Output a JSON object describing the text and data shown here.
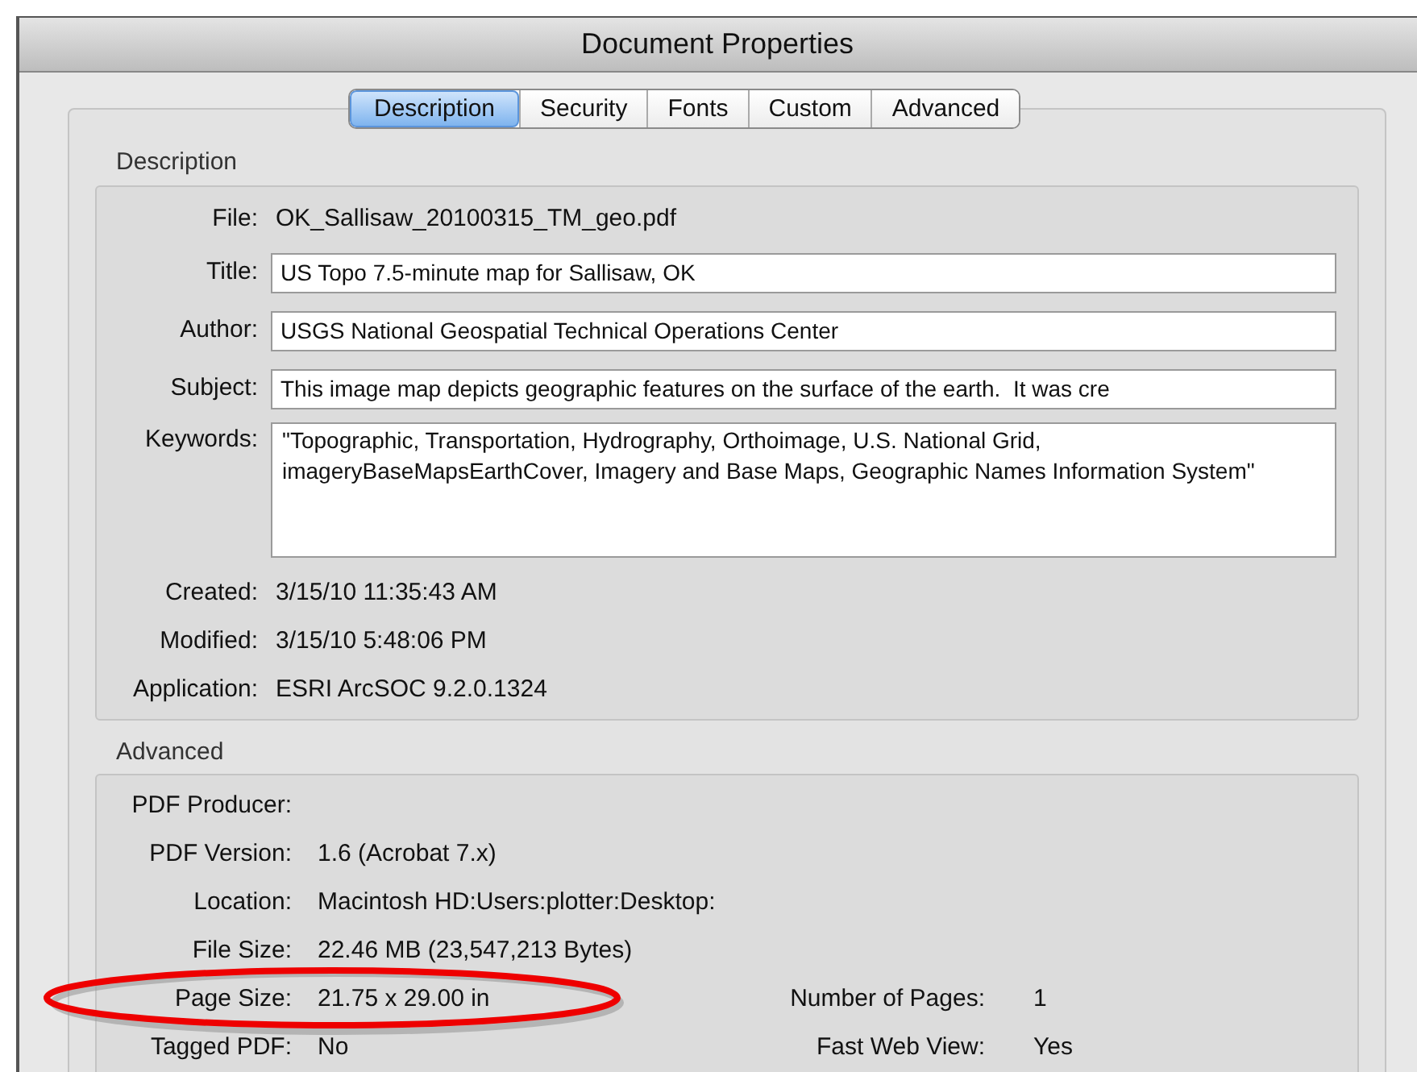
{
  "window": {
    "title": "Document Properties"
  },
  "tabs": [
    {
      "label": "Description",
      "selected": true
    },
    {
      "label": "Security",
      "selected": false
    },
    {
      "label": "Fonts",
      "selected": false
    },
    {
      "label": "Custom",
      "selected": false
    },
    {
      "label": "Advanced",
      "selected": false
    }
  ],
  "description": {
    "title": "Description",
    "fields": [
      {
        "kind": "text",
        "label": "File:",
        "value": "OK_Sallisaw_20100315_TM_geo.pdf"
      },
      {
        "kind": "input",
        "label": "Title:",
        "value": "US Topo 7.5-minute map for Sallisaw, OK"
      },
      {
        "kind": "input",
        "label": "Author:",
        "value": "USGS National Geospatial Technical Operations Center"
      },
      {
        "kind": "input",
        "label": "Subject:",
        "value": "This image map depicts geographic features on the surface of the earth.  It was cre"
      },
      {
        "kind": "textarea",
        "label": "Keywords:",
        "value": "\"Topographic, Transportation, Hydrography, Orthoimage, U.S. National Grid, imageryBaseMapsEarthCover, Imagery and Base Maps, Geographic Names Information System\""
      },
      {
        "kind": "text",
        "label": "Created:",
        "value": "3/15/10 11:35:43 AM"
      },
      {
        "kind": "text",
        "label": "Modified:",
        "value": "3/15/10 5:48:06 PM"
      },
      {
        "kind": "text",
        "label": "Application:",
        "value": "ESRI ArcSOC 9.2.0.1324"
      }
    ]
  },
  "advanced": {
    "title": "Advanced",
    "rows": [
      {
        "kind": "plain",
        "label": "PDF Producer:"
      },
      {
        "kind": "plain",
        "label": "PDF Version:",
        "value": "1.6 (Acrobat 7.x)"
      },
      {
        "kind": "plain",
        "label": "Location:",
        "value": "Macintosh HD:Users:plotter:Desktop:"
      },
      {
        "kind": "plain",
        "label": "File Size:",
        "value": "22.46 MB (23,547,213 Bytes)"
      },
      {
        "kind": "circled",
        "label": "Page Size:",
        "value": "21.75 x 29.00 in",
        "extra_label": "Number of Pages:",
        "extra_value": "1"
      },
      {
        "kind": "plain",
        "label": "Tagged PDF:",
        "value": "No",
        "extra_label": "Fast Web View:",
        "extra_value": "Yes"
      }
    ]
  }
}
